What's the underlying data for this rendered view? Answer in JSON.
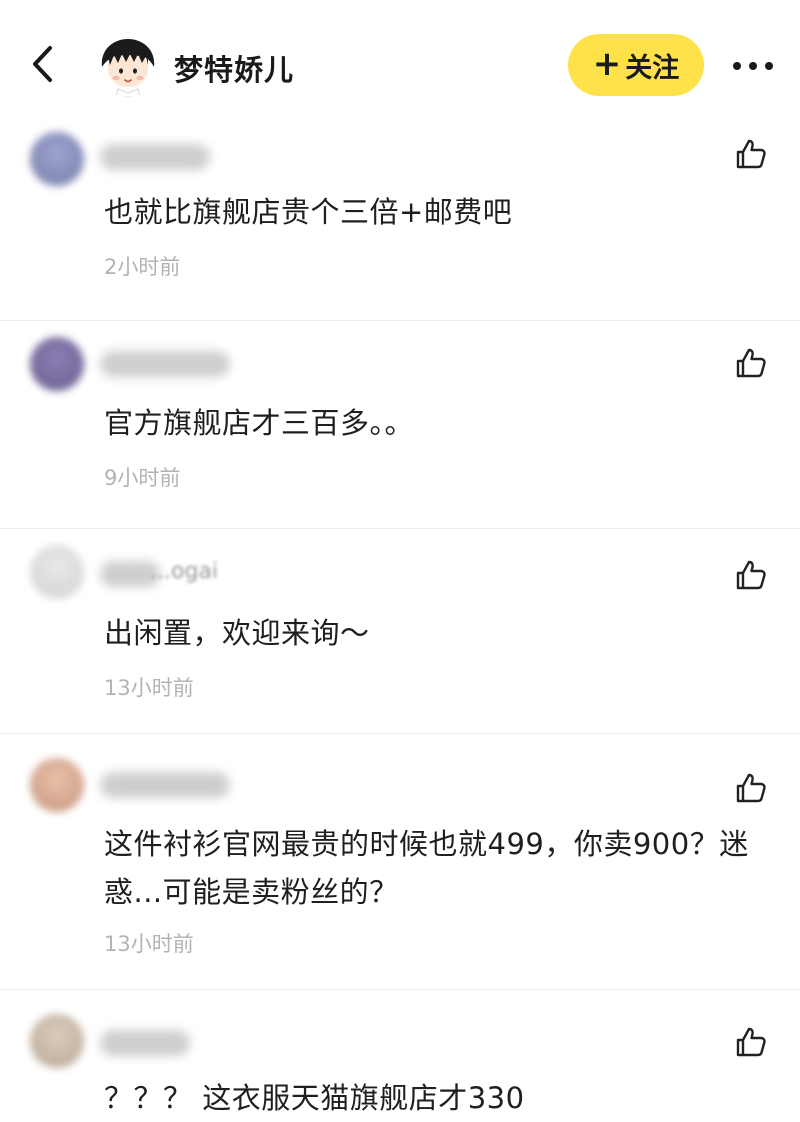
{
  "header": {
    "back_icon": "chevron-left-icon",
    "user_name": "梦特娇儿",
    "follow_label": "关注",
    "follow_plus": "+",
    "follow_color": "#ffe24a",
    "more_icon": "more-horizontal-icon"
  },
  "comments": [
    {
      "text": "也就比旗舰店贵个三倍+邮费吧",
      "time": "2小时前",
      "like_icon": "thumbs-up-icon"
    },
    {
      "text": "官方旗舰店才三百多。。",
      "time": "9小时前",
      "like_icon": "thumbs-up-icon"
    },
    {
      "username_partial": "...ogai",
      "text": "出闲置，欢迎来询～",
      "time": "13小时前",
      "like_icon": "thumbs-up-icon"
    },
    {
      "text": "这件衬衫官网最贵的时候也就499，你卖900？迷惑...可能是卖粉丝的？",
      "time": "13小时前",
      "like_icon": "thumbs-up-icon"
    },
    {
      "text": "？？？ 这衣服天猫旗舰店才330",
      "like_icon": "thumbs-up-icon"
    }
  ]
}
